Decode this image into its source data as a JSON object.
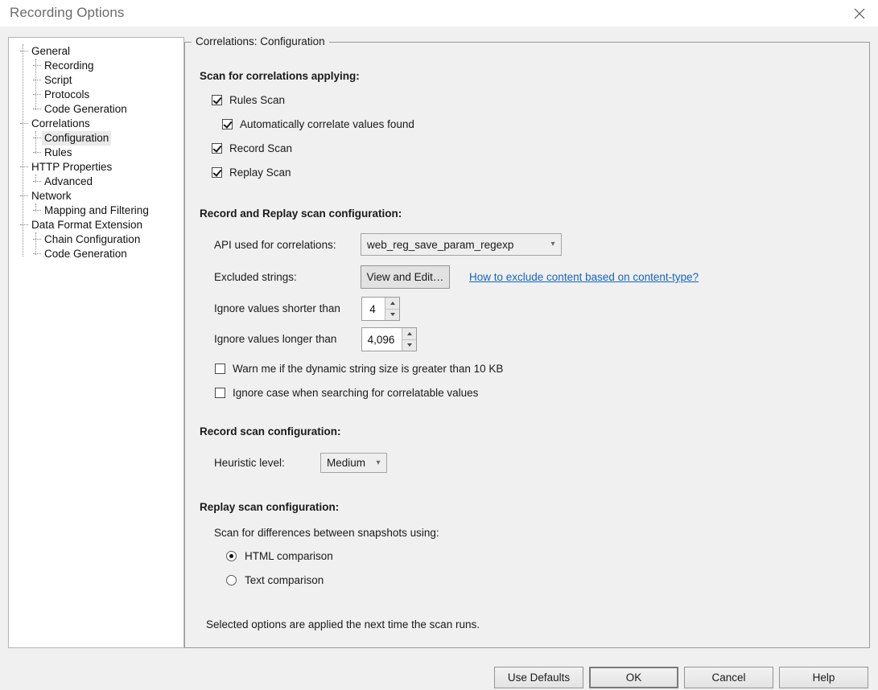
{
  "window": {
    "title": "Recording Options",
    "close_icon": "close-icon"
  },
  "sidebar": {
    "items": [
      {
        "label": "General",
        "level": 0,
        "selected": false
      },
      {
        "label": "Recording",
        "level": 1,
        "selected": false
      },
      {
        "label": "Script",
        "level": 1,
        "selected": false
      },
      {
        "label": "Protocols",
        "level": 1,
        "selected": false
      },
      {
        "label": "Code Generation",
        "level": 1,
        "selected": false
      },
      {
        "label": "Correlations",
        "level": 0,
        "selected": false
      },
      {
        "label": "Configuration",
        "level": 1,
        "selected": true
      },
      {
        "label": "Rules",
        "level": 1,
        "selected": false
      },
      {
        "label": "HTTP Properties",
        "level": 0,
        "selected": false
      },
      {
        "label": "Advanced",
        "level": 1,
        "selected": false
      },
      {
        "label": "Network",
        "level": 0,
        "selected": false
      },
      {
        "label": "Mapping and Filtering",
        "level": 1,
        "selected": false
      },
      {
        "label": "Data Format Extension",
        "level": 0,
        "selected": false
      },
      {
        "label": "Chain Configuration",
        "level": 1,
        "selected": false
      },
      {
        "label": "Code Generation",
        "level": 1,
        "selected": false
      }
    ]
  },
  "groupbox": {
    "title": "Correlations: Configuration"
  },
  "scan_applying": {
    "heading": "Scan for correlations applying:",
    "rules_scan": {
      "label": "Rules Scan",
      "checked": true
    },
    "auto_correlate": {
      "label": "Automatically correlate values found",
      "checked": true
    },
    "record_scan": {
      "label": "Record Scan",
      "checked": true
    },
    "replay_scan": {
      "label": "Replay Scan",
      "checked": true
    }
  },
  "record_replay": {
    "heading": "Record and Replay scan configuration:",
    "api_label": "API used for correlations:",
    "api_value": "web_reg_save_param_regexp",
    "excluded_label": "Excluded strings:",
    "excluded_button": "View and Edit…",
    "help_link": "How to exclude content based on content-type?",
    "shorter_label": "Ignore values shorter than",
    "shorter_value": "4",
    "longer_label": "Ignore values longer than",
    "longer_value": "4,096",
    "warn_checkbox": {
      "label": "Warn me if the dynamic string size is greater than 10 KB",
      "checked": false
    },
    "ignore_case_checkbox": {
      "label": "Ignore case when searching for correlatable values",
      "checked": false
    }
  },
  "record_scan": {
    "heading": "Record scan configuration:",
    "heuristic_label": "Heuristic level:",
    "heuristic_value": "Medium"
  },
  "replay_scan": {
    "heading": "Replay scan configuration:",
    "sub_label": "Scan for differences between snapshots using:",
    "html_option": {
      "label": "HTML comparison",
      "selected": true
    },
    "text_option": {
      "label": "Text comparison",
      "selected": false
    }
  },
  "footer_note": "Selected options are applied the next time the scan runs.",
  "buttons": {
    "use_defaults": "Use Defaults",
    "ok": "OK",
    "cancel": "Cancel",
    "help": "Help"
  },
  "colors": {
    "dialog_bg": "#f0f0f0",
    "titlebar_bg": "#ffffff",
    "link": "#1364c4",
    "selection": "#eaeaea"
  }
}
